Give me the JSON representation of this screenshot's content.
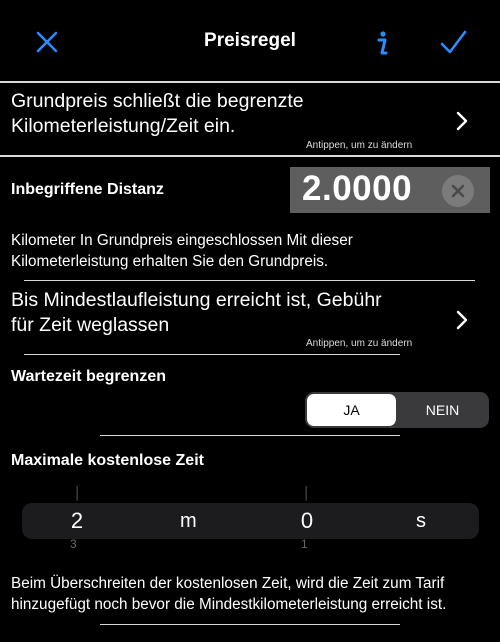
{
  "nav": {
    "title": "Preisregel",
    "colors": {
      "accent": "#2a8cff"
    }
  },
  "row_base_price": {
    "text": "Grundpreis schließt die begrenzte Kilometerleistung/Zeit ein.",
    "line1": "Grundpreis schließt die begrenzte",
    "line2": "Kilometerleistung/Zeit ein.",
    "hint": "Antippen, um zu ändern"
  },
  "included_distance": {
    "label": "Inbegriffene Distanz",
    "value": "2.0000",
    "desc_line1": "Kilometer In Grundpreis eingeschlossen Mit dieser",
    "desc_line2": "Kilometerleistung erhalten Sie den Grundpreis."
  },
  "row_min_mileage": {
    "line1": "Bis Mindestlaufleistung erreicht ist, Gebühr",
    "line2": "für Zeit weglassen",
    "hint": "Antippen, um zu ändern"
  },
  "limit_wait": {
    "label": "Wartezeit begrenzen",
    "options": [
      "JA",
      "NEIN"
    ],
    "selected": "JA"
  },
  "max_free_time": {
    "label": "Maximale kostenlose Zeit",
    "hours_value": "2",
    "hours_unit": "m",
    "minutes_value": "0",
    "minutes_unit": "s",
    "hours_next": "3",
    "minutes_next": "1"
  },
  "footer": {
    "line1": "Beim Überschreiten der kostenlosen Zeit, wird die Zeit zum Tarif",
    "line2": "hinzugefügt noch bevor die Mindestkilometerleistung erreicht ist."
  }
}
